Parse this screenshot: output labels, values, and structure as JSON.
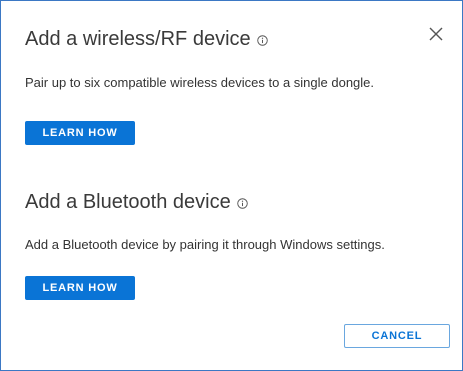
{
  "dialog": {
    "wireless_section": {
      "title": "Add a wireless/RF device",
      "info_icon": "info-circle-icon",
      "description": "Pair up to six compatible wireless devices to a single dongle.",
      "button_label": "LEARN HOW"
    },
    "bluetooth_section": {
      "title": "Add a Bluetooth device",
      "info_icon": "info-circle-icon",
      "description": "Add a Bluetooth device by pairing it through Windows settings.",
      "button_label": "LEARN HOW"
    },
    "close_icon": "close-icon",
    "cancel_label": "CANCEL"
  },
  "colors": {
    "accent": "#0a74d6",
    "border": "#3b78c4",
    "title_text": "#3a3a3a",
    "body_text": "#333333"
  }
}
